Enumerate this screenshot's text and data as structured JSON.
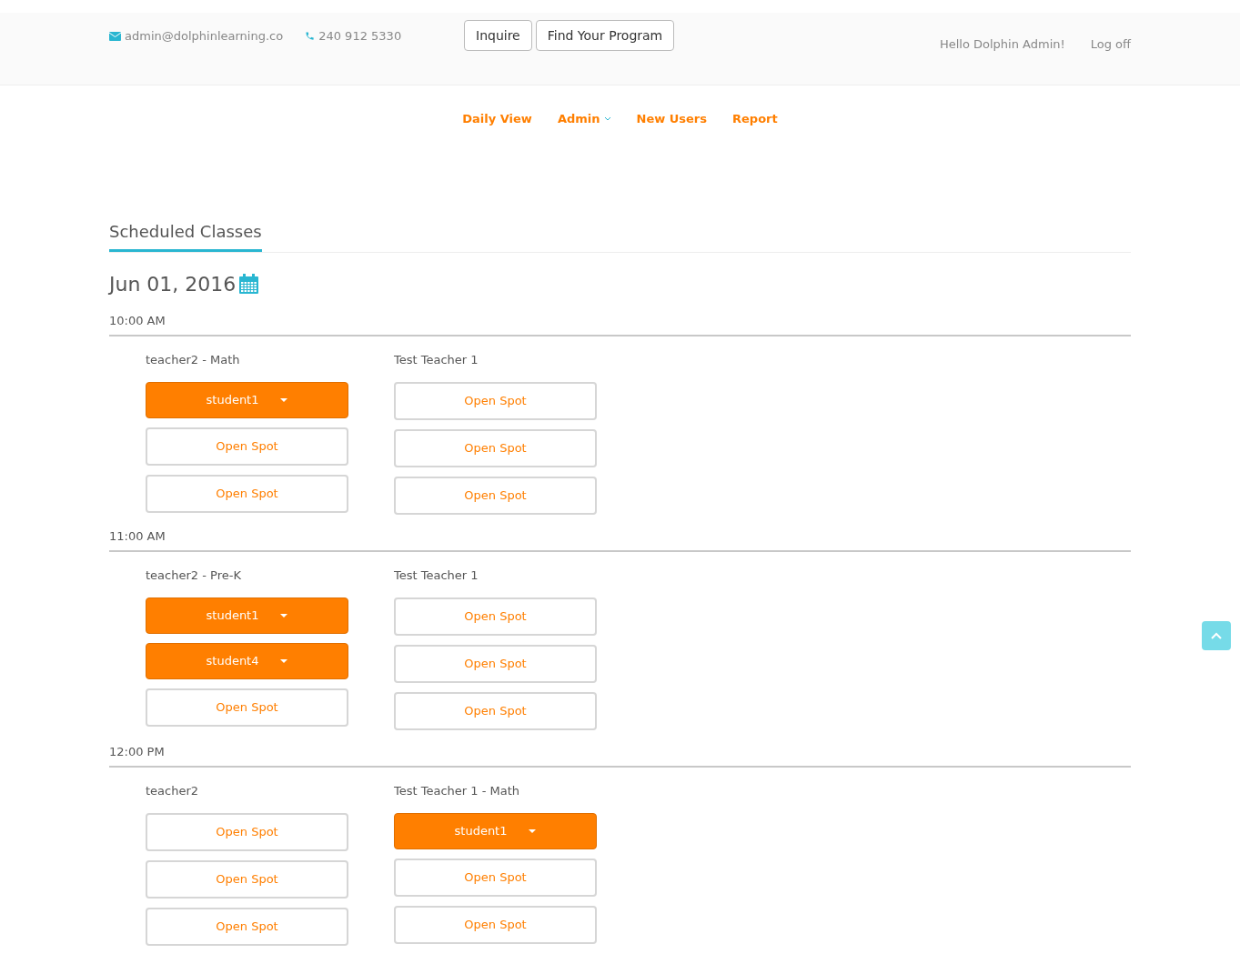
{
  "top_bar": {
    "email": "admin@dolphinlearning.co",
    "phone": "240 912 5330",
    "buttons": [
      "Inquire",
      "Find Your Program"
    ],
    "greeting": "Hello Dolphin Admin!",
    "logoff": "Log off"
  },
  "nav": [
    {
      "label": "Daily View",
      "has_menu": false
    },
    {
      "label": "Admin",
      "has_menu": true
    },
    {
      "label": "New Users",
      "has_menu": false
    },
    {
      "label": "Report",
      "has_menu": false
    }
  ],
  "section_title": "Scheduled Classes",
  "date": "Jun 01, 2016",
  "time_slots": [
    {
      "time": "10:00 AM",
      "classes": [
        {
          "teacher": "teacher2 - Math",
          "slots": [
            {
              "kind": "student",
              "label": "student1"
            },
            {
              "kind": "open",
              "label": "Open Spot"
            },
            {
              "kind": "open",
              "label": "Open Spot"
            }
          ]
        },
        {
          "teacher": "Test Teacher 1",
          "slots": [
            {
              "kind": "open",
              "label": "Open Spot"
            },
            {
              "kind": "open",
              "label": "Open Spot"
            },
            {
              "kind": "open",
              "label": "Open Spot"
            }
          ]
        }
      ]
    },
    {
      "time": "11:00 AM",
      "classes": [
        {
          "teacher": "teacher2 - Pre-K",
          "slots": [
            {
              "kind": "student",
              "label": "student1"
            },
            {
              "kind": "student",
              "label": "student4"
            },
            {
              "kind": "open",
              "label": "Open Spot"
            }
          ]
        },
        {
          "teacher": "Test Teacher 1",
          "slots": [
            {
              "kind": "open",
              "label": "Open Spot"
            },
            {
              "kind": "open",
              "label": "Open Spot"
            },
            {
              "kind": "open",
              "label": "Open Spot"
            }
          ]
        }
      ]
    },
    {
      "time": "12:00 PM",
      "classes": [
        {
          "teacher": "teacher2",
          "slots": [
            {
              "kind": "open",
              "label": "Open Spot"
            },
            {
              "kind": "open",
              "label": "Open Spot"
            },
            {
              "kind": "open",
              "label": "Open Spot"
            }
          ]
        },
        {
          "teacher": "Test Teacher 1 - Math",
          "slots": [
            {
              "kind": "student",
              "label": "student1"
            },
            {
              "kind": "open",
              "label": "Open Spot"
            },
            {
              "kind": "open",
              "label": "Open Spot"
            }
          ]
        }
      ]
    }
  ]
}
